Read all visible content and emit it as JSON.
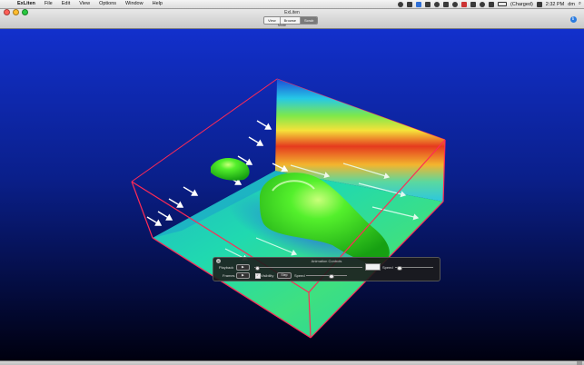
{
  "menubar": {
    "apple_symbol": "",
    "items": [
      "ExLiten",
      "File",
      "Edit",
      "View",
      "Options",
      "Window",
      "Help"
    ],
    "user": "(Charged)",
    "clock": "2:32 PM",
    "username": "dm",
    "search_symbol": "⌕"
  },
  "window": {
    "title": "ExLiten",
    "traffic_colors": {
      "close": "#ff5f57",
      "minimize": "#febc2e",
      "zoom": "#28c840"
    },
    "mode_buttons": [
      "View",
      "Browse",
      "Scrub"
    ],
    "selected_mode": "Scrub",
    "mode_label": "Mode",
    "get_info": {
      "icon": "info-icon",
      "glyph": "i",
      "label": "Get Info"
    }
  },
  "scene": {
    "background_top": "#0f2fc9",
    "background_bottom": "#000010",
    "floor_color": "#19d6b2",
    "body_color": "#39e028",
    "bbox_color": "#ff2a55",
    "arrow_color": "#ffffff"
  },
  "animation_controls": {
    "title": "Animation Controls",
    "close_symbol": "×",
    "playback_label": "Playback",
    "playback_button": "▶",
    "playback_progress": 0.02,
    "speed_label": "Speed",
    "speed_value": 0.1,
    "frames_label": "Frames",
    "frames_button": "▶",
    "visibility_label": "Visibility",
    "visibility_checked": true,
    "check_symbol": "✓",
    "step_label": "Step",
    "speed2_label": "Speed",
    "speed2_value": 0.6
  }
}
